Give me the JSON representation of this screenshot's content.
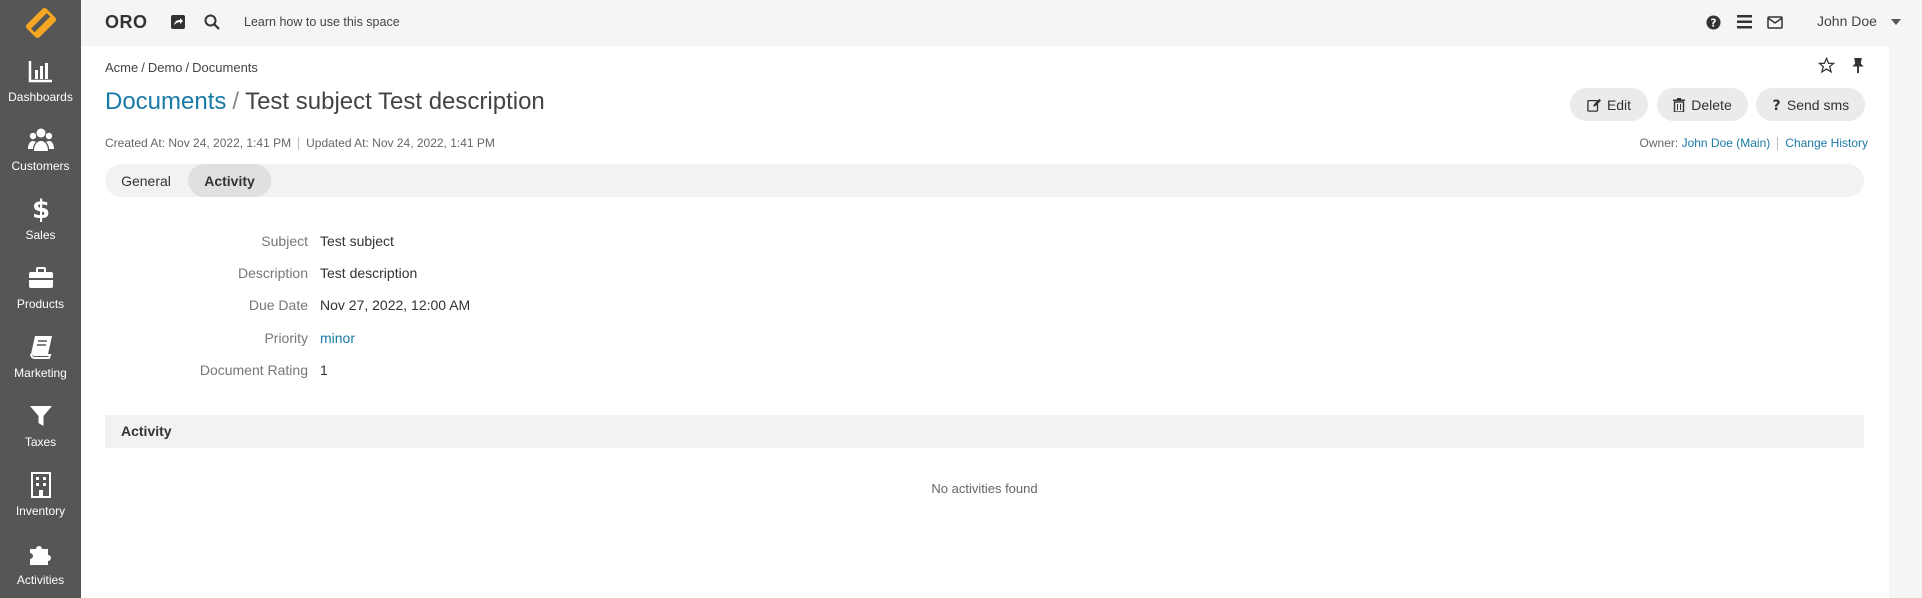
{
  "app": {
    "brand": "ORO",
    "help_link": "Learn how to use this space",
    "user_name": "John Doe"
  },
  "sidebar": {
    "items": [
      {
        "label": "Dashboards",
        "icon": "bar-chart-icon"
      },
      {
        "label": "Customers",
        "icon": "users-icon"
      },
      {
        "label": "Sales",
        "icon": "dollar-icon"
      },
      {
        "label": "Products",
        "icon": "briefcase-icon"
      },
      {
        "label": "Marketing",
        "icon": "book-icon"
      },
      {
        "label": "Taxes",
        "icon": "filter-icon"
      },
      {
        "label": "Inventory",
        "icon": "building-icon"
      },
      {
        "label": "Activities",
        "icon": "puzzle-icon"
      }
    ]
  },
  "breadcrumb": {
    "items": [
      "Acme",
      "Demo",
      "Documents"
    ],
    "separator": "/"
  },
  "page": {
    "entity": "Documents",
    "slash": "/",
    "record_title": "Test subject Test description",
    "created": "Created At: Nov 24, 2022, 1:41 PM",
    "updated": "Updated At: Nov 24, 2022, 1:41 PM",
    "owner_label": "Owner:",
    "owner_value": "John Doe (Main)",
    "change_history": "Change History"
  },
  "actions": {
    "edit": "Edit",
    "delete": "Delete",
    "send_sms": "Send sms"
  },
  "tabs": [
    {
      "label": "General"
    },
    {
      "label": "Activity"
    }
  ],
  "fields": [
    {
      "label": "Subject",
      "value": "Test subject"
    },
    {
      "label": "Description",
      "value": "Test description"
    },
    {
      "label": "Due Date",
      "value": "Nov 27, 2022, 12:00 AM"
    },
    {
      "label": "Priority",
      "value": "minor"
    },
    {
      "label": "Document Rating",
      "value": "1"
    }
  ],
  "activity_section": {
    "title": "Activity",
    "empty_text": "No activities found"
  },
  "colors": {
    "sidebar": "#565656",
    "link": "#1a7aa6",
    "logo": "#f5a623"
  }
}
